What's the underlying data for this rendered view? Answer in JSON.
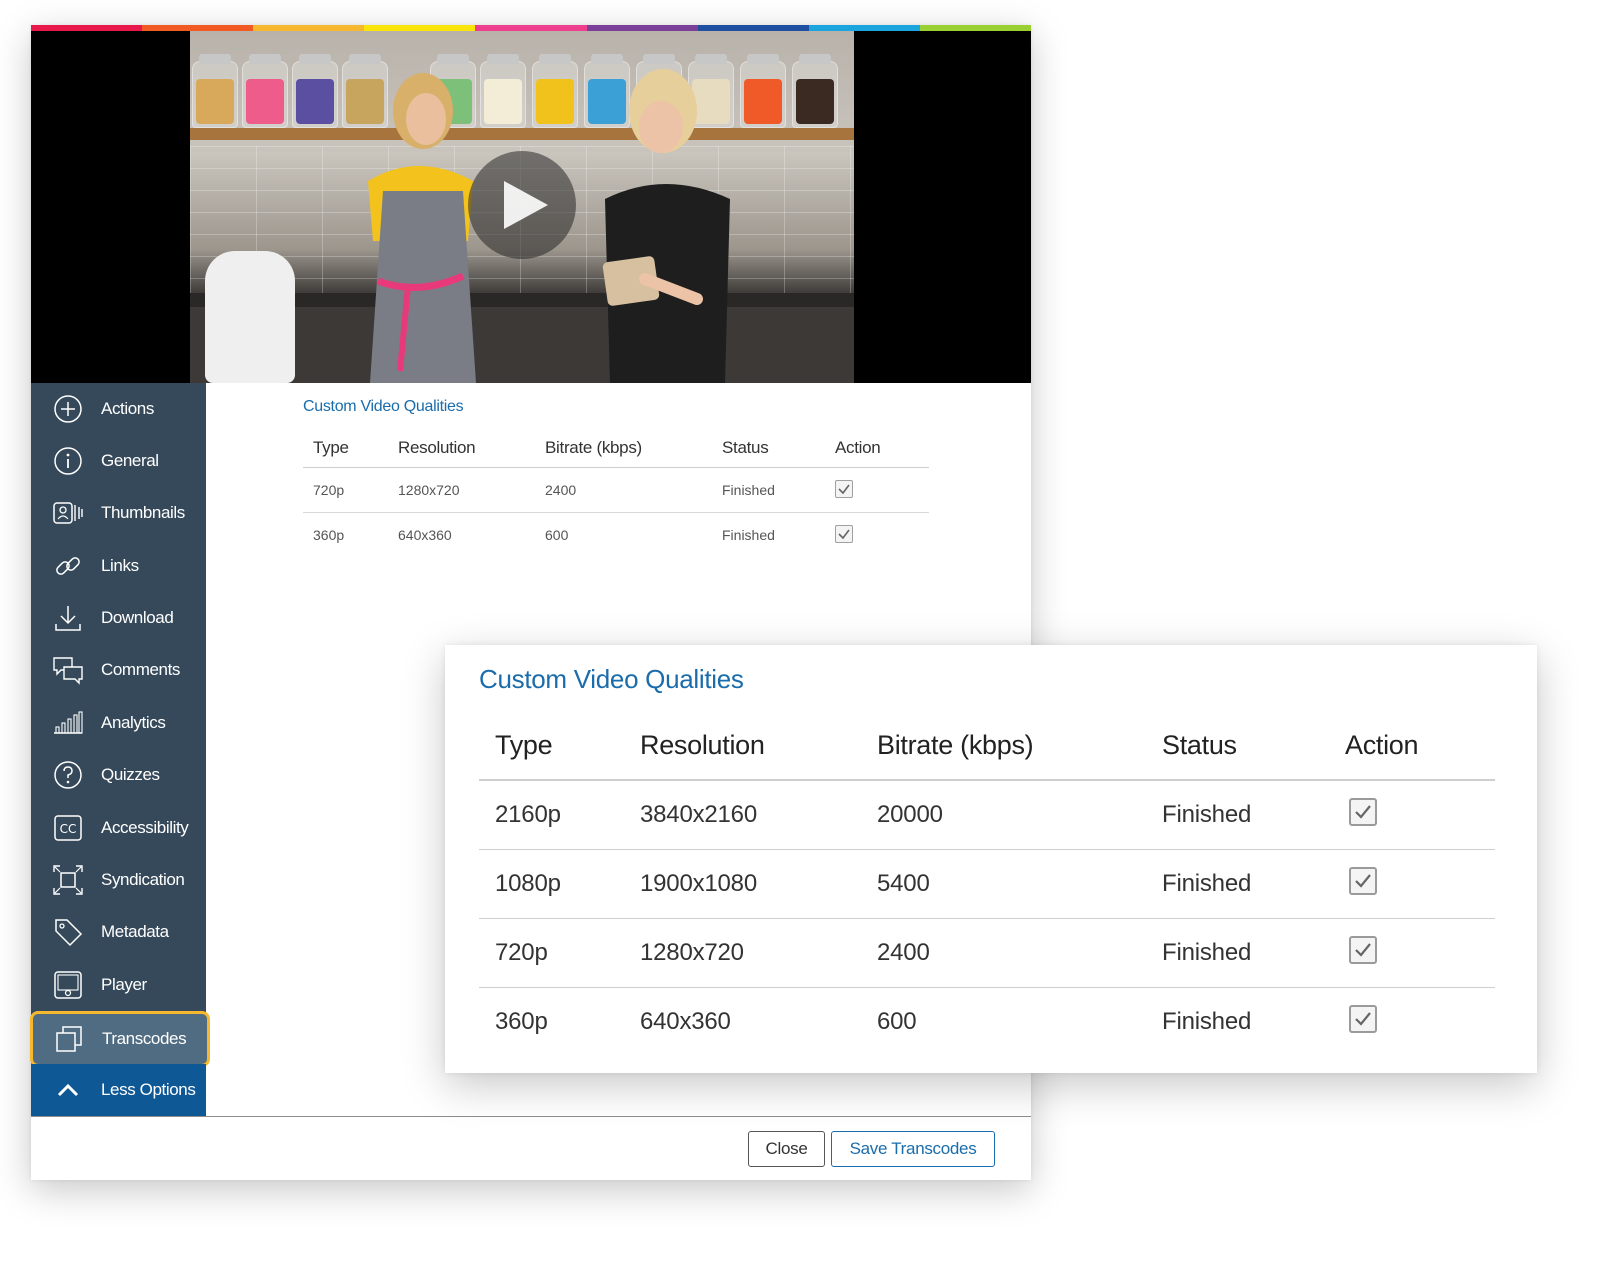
{
  "colors": {
    "rainbow": [
      "#e8184a",
      "#f15a22",
      "#f5b82e",
      "#f9e50a",
      "#ee3f8f",
      "#7a3f98",
      "#1f4fa0",
      "#1aa5df",
      "#9bd033"
    ],
    "sidebar_bg": "#35495a",
    "sidebar_active_bg": "#4f6c82",
    "active_outline": "#f5b82e",
    "less_options_bg": "#0f5896",
    "accent_blue": "#1a6cab"
  },
  "video": {
    "play_icon": "play-icon"
  },
  "sidebar": {
    "items": [
      {
        "label": "Actions",
        "icon": "plus-circle-icon"
      },
      {
        "label": "General",
        "icon": "info-circle-icon"
      },
      {
        "label": "Thumbnails",
        "icon": "thumbnails-icon"
      },
      {
        "label": "Links",
        "icon": "link-icon"
      },
      {
        "label": "Download",
        "icon": "download-icon"
      },
      {
        "label": "Comments",
        "icon": "comments-icon"
      },
      {
        "label": "Analytics",
        "icon": "analytics-icon"
      },
      {
        "label": "Quizzes",
        "icon": "question-circle-icon"
      },
      {
        "label": "Accessibility",
        "icon": "closed-caption-icon"
      },
      {
        "label": "Syndication",
        "icon": "syndication-icon"
      },
      {
        "label": "Metadata",
        "icon": "tag-icon"
      },
      {
        "label": "Player",
        "icon": "player-icon"
      },
      {
        "label": "Transcodes",
        "icon": "transcodes-icon",
        "active": true
      }
    ],
    "less_options": {
      "label": "Less Options",
      "icon": "chevron-up-icon"
    }
  },
  "small_panel": {
    "title": "Custom Video Qualities",
    "headers": [
      "Type",
      "Resolution",
      "Bitrate (kbps)",
      "Status",
      "Action"
    ],
    "rows": [
      {
        "type": "720p",
        "resolution": "1280x720",
        "bitrate": "2400",
        "status": "Finished",
        "checked": true
      },
      {
        "type": "360p",
        "resolution": "640x360",
        "bitrate": "600",
        "status": "Finished",
        "checked": true
      }
    ]
  },
  "footer": {
    "close_label": "Close",
    "save_label": "Save Transcodes"
  },
  "zoom_panel": {
    "title": "Custom Video Qualities",
    "headers": [
      "Type",
      "Resolution",
      "Bitrate (kbps)",
      "Status",
      "Action"
    ],
    "rows": [
      {
        "type": "2160p",
        "resolution": "3840x2160",
        "bitrate": "20000",
        "status": "Finished",
        "checked": true
      },
      {
        "type": "1080p",
        "resolution": "1900x1080",
        "bitrate": "5400",
        "status": "Finished",
        "checked": true
      },
      {
        "type": "720p",
        "resolution": "1280x720",
        "bitrate": "2400",
        "status": "Finished",
        "checked": true
      },
      {
        "type": "360p",
        "resolution": "640x360",
        "bitrate": "600",
        "status": "Finished",
        "checked": true
      }
    ]
  }
}
